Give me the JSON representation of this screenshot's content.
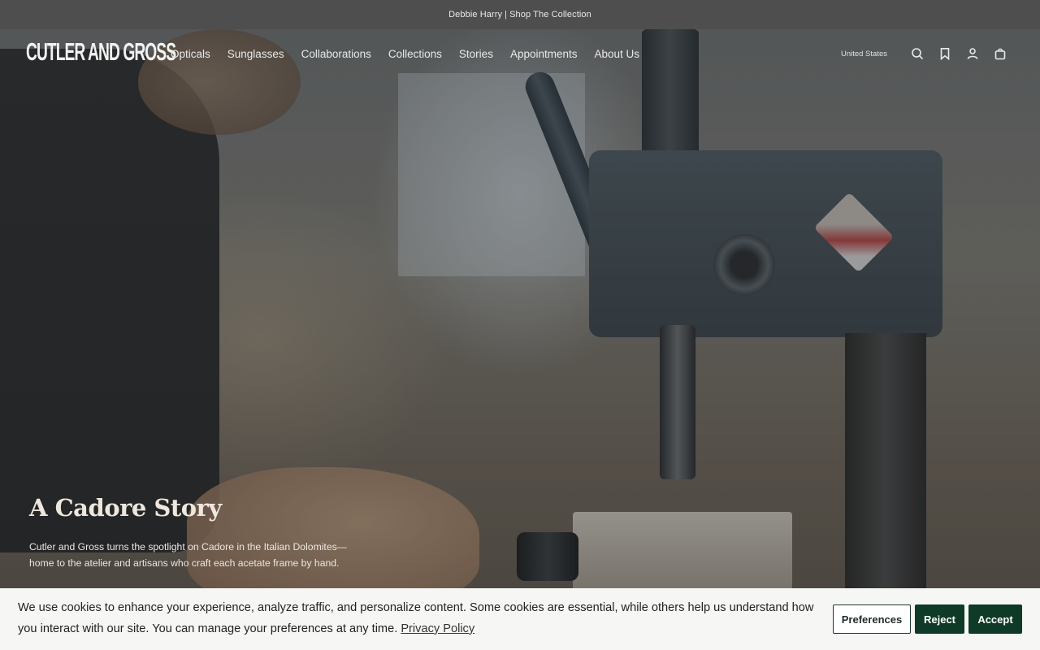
{
  "announcement": {
    "text_part1": "Debbie Harry",
    "separator": "|",
    "link": "Shop The Collection"
  },
  "brand": {
    "logo_text": "CUTLER AND GROSS"
  },
  "nav": {
    "items": [
      {
        "label": "Opticals"
      },
      {
        "label": "Sunglasses"
      },
      {
        "label": "Collaborations"
      },
      {
        "label": "Collections"
      },
      {
        "label": "Stories"
      },
      {
        "label": "Appointments"
      },
      {
        "label": "About Us"
      }
    ]
  },
  "utility": {
    "region": "United States",
    "icons": [
      "search-icon",
      "bookmark-icon",
      "account-icon",
      "bag-icon"
    ]
  },
  "hero": {
    "title": "A Cadore Story",
    "description": "Cutler and Gross turns the spotlight on Cadore in the Italian Dolomites—home to the atelier and artisans who craft each acetate frame by hand."
  },
  "cookie": {
    "text": "We use cookies to enhance your experience, analyze traffic, and personalize content. Some cookies are essential, while others help us understand how you interact with our site. You can manage your preferences at any time.",
    "policy_link": "Privacy Policy",
    "buttons": {
      "preferences": "Preferences",
      "reject": "Reject",
      "accept": "Accept"
    }
  },
  "colors": {
    "accent": "#0f3a28",
    "banner_bg": "#f6f6f4",
    "announcement_bg": "#4e4e4e"
  }
}
